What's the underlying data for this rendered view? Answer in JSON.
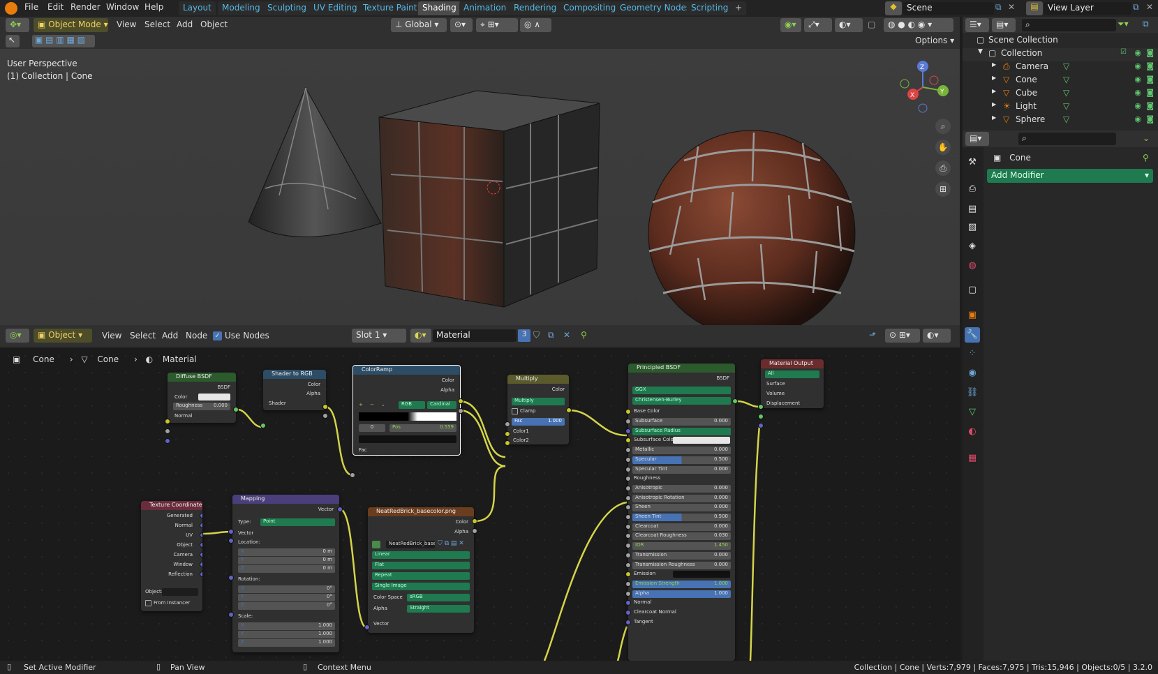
{
  "topbar": {
    "menus": [
      "File",
      "Edit",
      "Render",
      "Window",
      "Help"
    ],
    "workspaces": [
      "Layout",
      "Modeling",
      "Sculpting",
      "UV Editing",
      "Texture Paint",
      "Shading",
      "Animation",
      "Rendering",
      "Compositing",
      "Geometry Nodes",
      "Scripting"
    ],
    "active_workspace": "Shading",
    "add_workspace": "+",
    "scene": "Scene",
    "view_layer": "View Layer"
  },
  "viewport": {
    "mode": "Object Mode",
    "menus": [
      "View",
      "Select",
      "Add",
      "Object"
    ],
    "transform_orientation": "Global",
    "options": "Options",
    "overlay_title": "User Perspective",
    "overlay_subtitle": "(1) Collection | Cone",
    "gizmo": {
      "x": "X",
      "y": "Y",
      "z": "Z"
    }
  },
  "node_editor": {
    "type": "Object",
    "menus": [
      "View",
      "Select",
      "Add",
      "Node"
    ],
    "use_nodes_label": "Use Nodes",
    "slot": "Slot 1",
    "material": "Material",
    "users": "3",
    "breadcrumb": [
      "Cone",
      "Cone",
      "Material"
    ]
  },
  "nodes": {
    "diffuse": {
      "title": "Diffuse BSDF",
      "out": "BSDF",
      "color": "Color",
      "roughness": "Roughness",
      "roughness_val": "0.000",
      "normal": "Normal"
    },
    "shader_rgb": {
      "title": "Shader to RGB",
      "color": "Color",
      "alpha": "Alpha",
      "shader": "Shader"
    },
    "colorramp": {
      "title": "ColorRamp",
      "color": "Color",
      "alpha": "Alpha",
      "mode": "RGB",
      "interp": "Cardinal",
      "index": "0",
      "pos_label": "Pos",
      "pos": "0.559",
      "fac": "Fac",
      "controls": [
        "+",
        "−",
        "⌄"
      ]
    },
    "multiply": {
      "title": "Multiply",
      "color": "Color",
      "blend": "Multiply",
      "clamp": "Clamp",
      "fac": "Fac",
      "fac_val": "1.000",
      "color1": "Color1",
      "color2": "Color2"
    },
    "principled": {
      "title": "Principled BSDF",
      "out": "BSDF",
      "distribution": "GGX",
      "subsurface_method": "Christensen-Burley",
      "base_color": "Base Color",
      "rows": [
        {
          "label": "Subsurface",
          "value": "0.000"
        },
        {
          "label": "Subsurface Radius",
          "value": ""
        },
        {
          "label": "Subsurface Color",
          "value": ""
        },
        {
          "label": "Metallic",
          "value": "0.000"
        },
        {
          "label": "Specular",
          "value": "0.500"
        },
        {
          "label": "Specular Tint",
          "value": "0.000"
        },
        {
          "label": "Roughness",
          "value": ""
        },
        {
          "label": "Anisotropic",
          "value": "0.000"
        },
        {
          "label": "Anisotropic Rotation",
          "value": "0.000"
        },
        {
          "label": "Sheen",
          "value": "0.000"
        },
        {
          "label": "Sheen Tint",
          "value": "0.500"
        },
        {
          "label": "Clearcoat",
          "value": "0.000"
        },
        {
          "label": "Clearcoat Roughness",
          "value": "0.030"
        },
        {
          "label": "IOR",
          "value": "1.450"
        },
        {
          "label": "Transmission",
          "value": "0.000"
        },
        {
          "label": "Transmission Roughness",
          "value": "0.000"
        },
        {
          "label": "Emission",
          "value": ""
        },
        {
          "label": "Emission Strength",
          "value": "1.000"
        },
        {
          "label": "Alpha",
          "value": "1.000"
        },
        {
          "label": "Normal",
          "value": ""
        },
        {
          "label": "Clearcoat Normal",
          "value": ""
        },
        {
          "label": "Tangent",
          "value": ""
        }
      ]
    },
    "output": {
      "title": "Material Output",
      "target": "All",
      "surface": "Surface",
      "volume": "Volume",
      "displacement": "Displacement"
    },
    "texcoord": {
      "title": "Texture Coordinate",
      "outs": [
        "Generated",
        "Normal",
        "UV",
        "Object",
        "Camera",
        "Window",
        "Reflection"
      ],
      "object": "Object:",
      "from_instancer": "From Instancer"
    },
    "mapping": {
      "title": "Mapping",
      "out": "Vector",
      "type_label": "Type:",
      "type": "Point",
      "vector": "Vector",
      "location": "Location:",
      "rotation": "Rotation:",
      "scale": "Scale:",
      "loc": [
        {
          "a": "X",
          "v": "0 m"
        },
        {
          "a": "Y",
          "v": "0 m"
        },
        {
          "a": "Z",
          "v": "0 m"
        }
      ],
      "rot": [
        {
          "a": "X",
          "v": "0°"
        },
        {
          "a": "Y",
          "v": "0°"
        },
        {
          "a": "Z",
          "v": "0°"
        }
      ],
      "scl": [
        {
          "a": "X",
          "v": "1.000"
        },
        {
          "a": "Y",
          "v": "1.000"
        },
        {
          "a": "Z",
          "v": "1.000"
        }
      ]
    },
    "image": {
      "title": "NeatRedBrick_basecolor.png",
      "color": "Color",
      "alpha": "Alpha",
      "image_name": "NeatRedBrick_base...",
      "interp": "Linear",
      "proj": "Flat",
      "ext": "Repeat",
      "source": "Single Image",
      "cs_label": "Color Space",
      "cs": "sRGB",
      "alpha_label": "Alpha",
      "alpha_mode": "Straight",
      "vector": "Vector"
    }
  },
  "outliner": {
    "root": "Scene Collection",
    "collection": "Collection",
    "items": [
      "Camera",
      "Cone",
      "Cube",
      "Light",
      "Sphere"
    ]
  },
  "properties": {
    "object": "Cone",
    "add_modifier": "Add Modifier"
  },
  "statusbar": {
    "left": "Set Active Modifier",
    "mid": "Pan View",
    "right": "Context Menu",
    "stats": "Collection | Cone | Verts:7,979 | Faces:7,975 | Tris:15,946 | Objects:0/5 | 3.2.0"
  },
  "colors": {
    "accent": "#4772b3",
    "active_mode": "#d4a017",
    "ws_text": "#55b9e6",
    "socket_yellow": "#c7c729",
    "socket_green": "#63c763",
    "socket_blue": "#6363c7",
    "eye_green": "#5fc66d"
  }
}
